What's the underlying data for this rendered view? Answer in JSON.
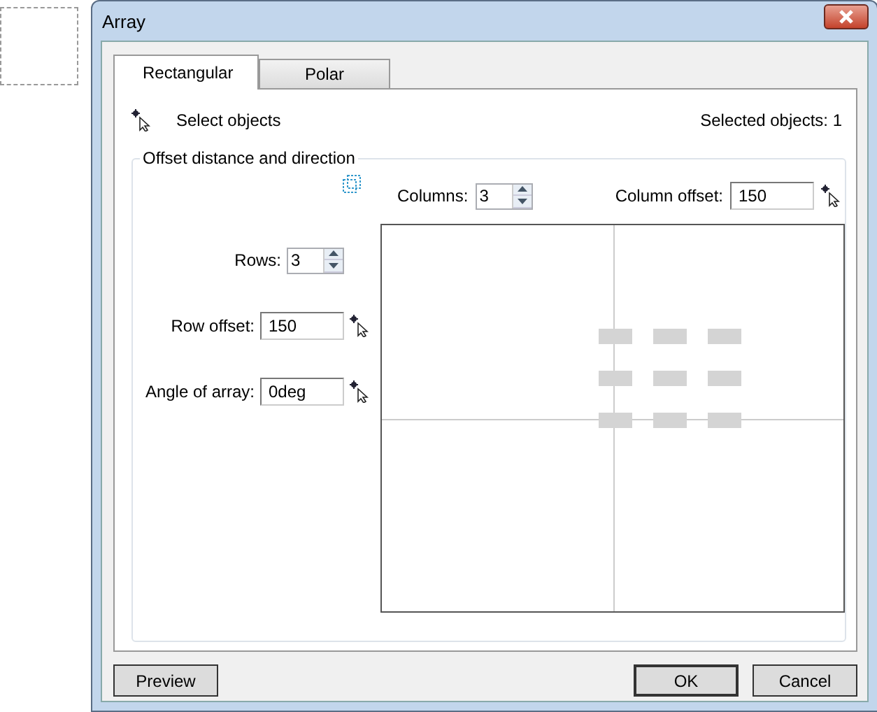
{
  "window": {
    "title": "Array"
  },
  "tabs": [
    {
      "label": "Rectangular",
      "selected": true
    },
    {
      "label": "Polar",
      "selected": false
    }
  ],
  "select_objects": {
    "label": "Select objects"
  },
  "selected_count": "Selected objects: 1",
  "group": {
    "title": "Offset distance and direction"
  },
  "columns": {
    "label": "Columns:",
    "value": "3"
  },
  "column_offset": {
    "label": "Column offset:",
    "value": "150"
  },
  "rows": {
    "label": "Rows:",
    "value": "3"
  },
  "row_offset": {
    "label": "Row offset:",
    "value": "150"
  },
  "angle": {
    "label": "Angle of array:",
    "value": "0deg"
  },
  "buttons": [
    {
      "label": "Preview",
      "default": false
    },
    {
      "label": "OK",
      "default": true
    },
    {
      "label": "Cancel",
      "default": false
    }
  ]
}
